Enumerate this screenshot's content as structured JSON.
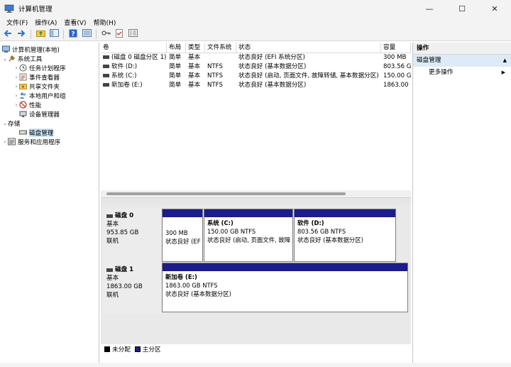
{
  "window": {
    "title": "计算机管理",
    "minimize": "—",
    "maximize": "☐",
    "close": "✕"
  },
  "menu": [
    "文件(F)",
    "操作(A)",
    "查看(V)",
    "帮助(H)"
  ],
  "tree": {
    "root": "计算机管理(本地)",
    "system_tools": "系统工具",
    "task_scheduler": "任务计划程序",
    "event_viewer": "事件查看器",
    "shared_folders": "共享文件夹",
    "local_users": "本地用户和组",
    "performance": "性能",
    "device_manager": "设备管理器",
    "storage": "存储",
    "disk_management": "磁盘管理",
    "services": "服务和应用程序"
  },
  "volume_table": {
    "headers": [
      "卷",
      "布局",
      "类型",
      "文件系统",
      "状态",
      "容量"
    ],
    "rows": [
      [
        "(磁盘 0 磁盘分区 1)",
        "简单",
        "基本",
        "",
        "状态良好 (EFI 系统分区)",
        "300 MB"
      ],
      [
        "软件 (D:)",
        "简单",
        "基本",
        "NTFS",
        "状态良好 (基本数据分区)",
        "803.56 G"
      ],
      [
        "系统 (C:)",
        "简单",
        "基本",
        "NTFS",
        "状态良好 (启动, 页面文件, 故障转储, 基本数据分区)",
        "150.00 G"
      ],
      [
        "新加卷 (E:)",
        "简单",
        "基本",
        "NTFS",
        "状态良好 (基本数据分区)",
        "1863.00"
      ]
    ]
  },
  "disks": [
    {
      "name": "磁盘 0",
      "type": "基本",
      "size": "953.85 GB",
      "status": "联机",
      "partitions": [
        {
          "title": "",
          "size": "300 MB",
          "status": "状态良好 (EF"
        },
        {
          "title": "系统 (C:)",
          "size": "150.00 GB NTFS",
          "status": "状态良好 (启动, 页面文件, 故障"
        },
        {
          "title": "软件 (D:)",
          "size": "803.56 GB NTFS",
          "status": "状态良好 (基本数据分区)"
        }
      ]
    },
    {
      "name": "磁盘 1",
      "type": "基本",
      "size": "1863.00 GB",
      "status": "联机",
      "partitions": [
        {
          "title": "新加卷 (E:)",
          "size": "1863.00 GB NTFS",
          "status": "状态良好 (基本数据分区)"
        }
      ]
    }
  ],
  "legend": {
    "unallocated": "未分配",
    "primary": "主分区"
  },
  "actions": {
    "header": "操作",
    "section": "磁盘管理",
    "more": "更多操作"
  },
  "colors": {
    "partition_bar": "#1c1c8c",
    "selection": "#cce4f7",
    "action_section": "#dcebf7"
  }
}
